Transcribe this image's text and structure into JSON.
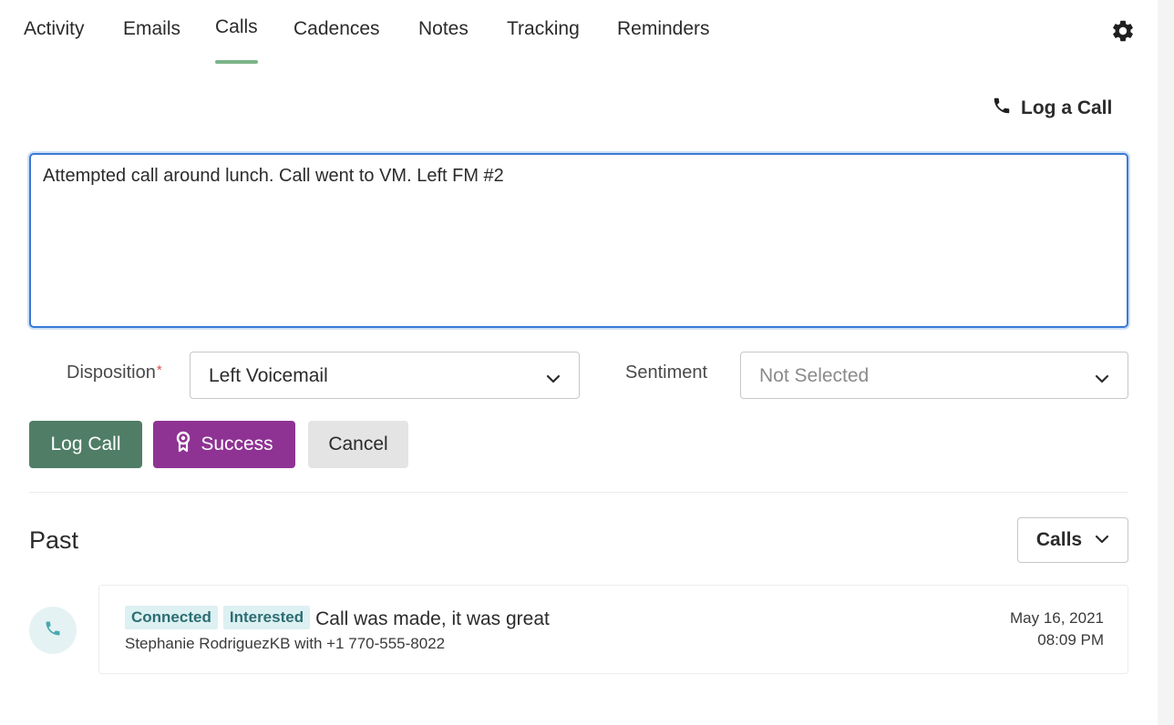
{
  "tabs": [
    {
      "label": "Activity"
    },
    {
      "label": "Emails"
    },
    {
      "label": "Calls"
    },
    {
      "label": "Cadences"
    },
    {
      "label": "Notes"
    },
    {
      "label": "Tracking"
    },
    {
      "label": "Reminders"
    }
  ],
  "active_tab": "Calls",
  "header": {
    "log_call_label": "Log a Call"
  },
  "form": {
    "notes_value": "Attempted call around lunch. Call went to VM. Left FM #2",
    "disposition_label": "Disposition",
    "required_marker": "*",
    "disposition_value": "Left Voicemail",
    "sentiment_label": "Sentiment",
    "sentiment_value": "Not Selected"
  },
  "buttons": {
    "log_call": "Log Call",
    "success": "Success",
    "cancel": "Cancel"
  },
  "past": {
    "title": "Past",
    "filter_value": "Calls",
    "calls": [
      {
        "badges": [
          "Connected",
          "Interested"
        ],
        "summary": "Call was made, it was great",
        "detail": "Stephanie RodriguezKB with +1 770-555-8022",
        "date": "May 16, 2021",
        "time": "08:09 PM"
      }
    ]
  },
  "colors": {
    "active_tab_underline": "#7bb488",
    "log_call_button": "#4f7d66",
    "success_button": "#8e3393",
    "cancel_button": "#e4e4e4",
    "focus_border": "#3a78d6",
    "badge_bg": "#ddf0f2",
    "badge_text": "#2c6e73"
  },
  "icons": {
    "settings": "gear-icon",
    "log_call": "phone-icon",
    "success": "award-ribbon-icon",
    "dropdown": "chevron-down-icon",
    "call_entry": "phone-icon"
  }
}
